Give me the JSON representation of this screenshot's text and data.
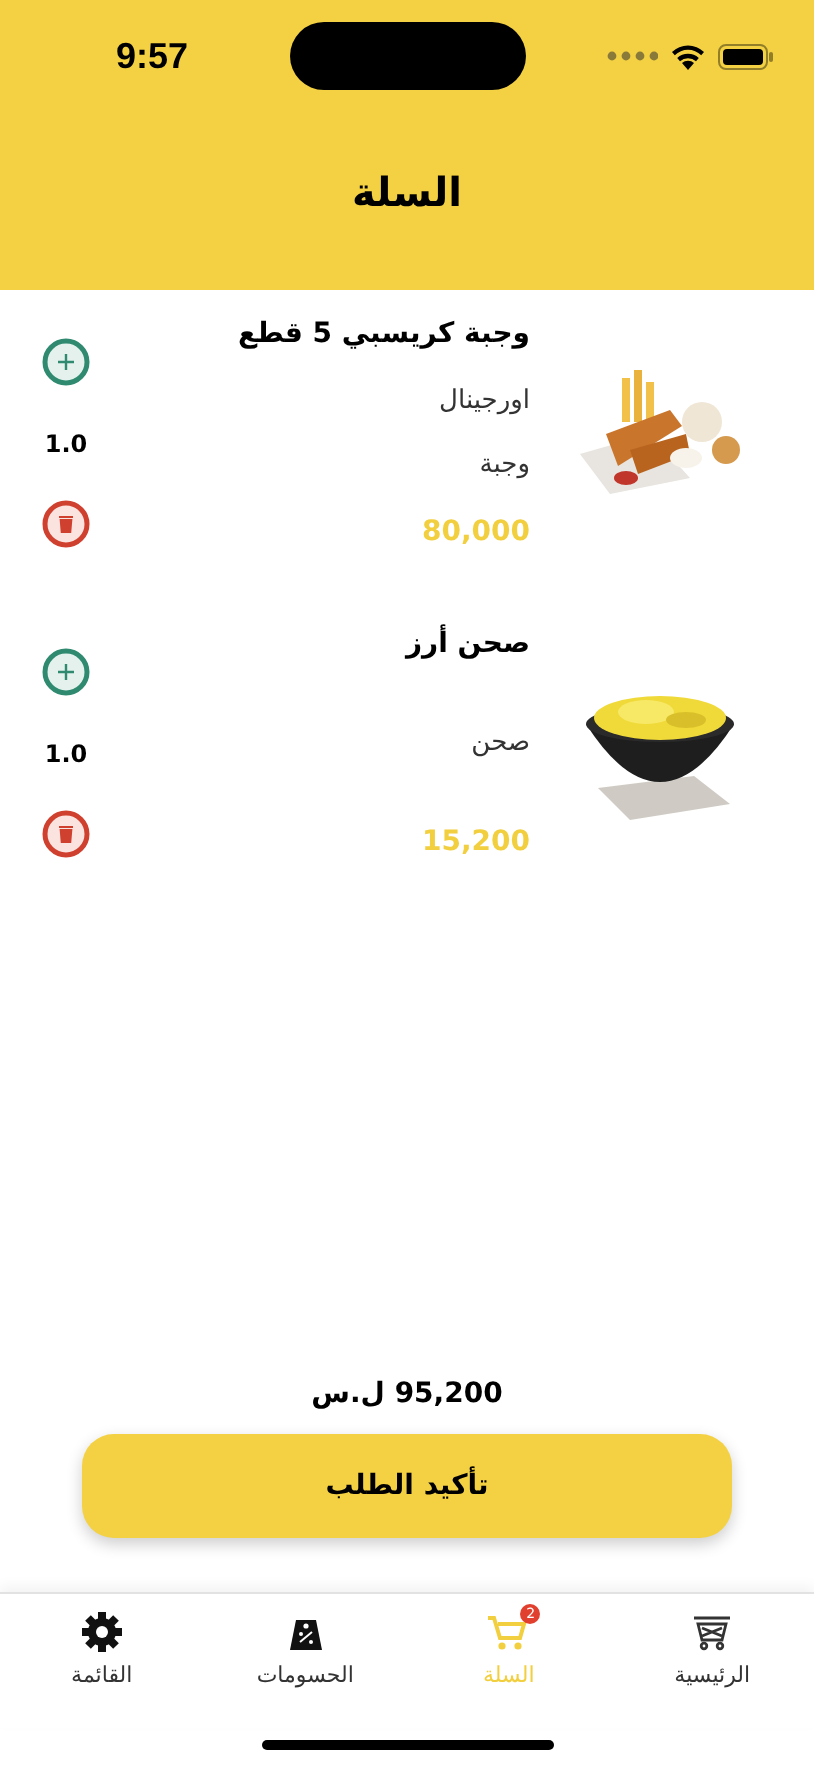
{
  "status_bar": {
    "time": "9:57"
  },
  "header": {
    "title": "السلة"
  },
  "items": [
    {
      "name": "وجبة كريسبي 5 قطع",
      "details": [
        "اورجينال",
        "وجبة"
      ],
      "price": "80,000",
      "quantity": "1.0",
      "image": {
        "kind": "picture"
      }
    },
    {
      "name": "صحن أرز",
      "details": [
        "صحن"
      ],
      "price": "15,200",
      "quantity": "1.0",
      "image": {
        "kind": "picture"
      }
    }
  ],
  "total": "95,200 ل.س",
  "confirm_button": "تأكيد الطلب",
  "tab_bar": [
    {
      "label": "الرئيسية",
      "selected": false
    },
    {
      "label": "السلة",
      "selected": true,
      "badge": "2"
    },
    {
      "label": "الحسومات",
      "selected": false
    },
    {
      "label": "القائمة",
      "selected": false
    }
  ]
}
